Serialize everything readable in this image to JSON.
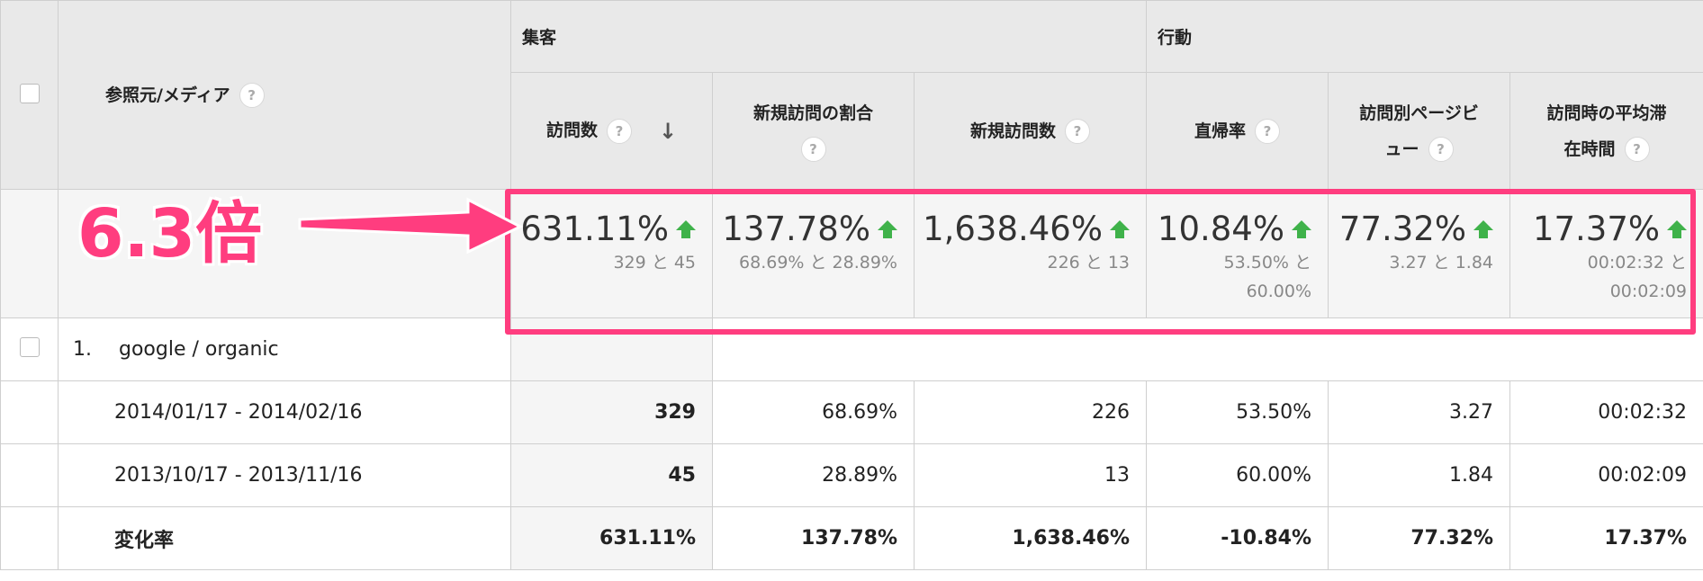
{
  "table": {
    "source_header": "参照元/メディア",
    "group_acquisition": "集客",
    "group_behavior": "行動",
    "columns": [
      {
        "label_lines": [
          "訪問数"
        ],
        "sorted": true
      },
      {
        "label_lines": [
          "新規訪問の割合"
        ]
      },
      {
        "label_lines": [
          "新規訪問数"
        ]
      },
      {
        "label_lines": [
          "直帰率"
        ]
      },
      {
        "label_lines": [
          "訪問別ページビ",
          "ュー"
        ]
      },
      {
        "label_lines": [
          "訪問時の平均滞",
          "在時間"
        ]
      }
    ],
    "summary": [
      {
        "pct": "631.11%",
        "lines": [
          "329 と 45"
        ]
      },
      {
        "pct": "137.78%",
        "lines": [
          "68.69% と 28.89%"
        ]
      },
      {
        "pct": "1,638.46%",
        "lines": [
          "226 と 13"
        ]
      },
      {
        "pct": "10.84%",
        "lines": [
          "53.50% と",
          "60.00%"
        ]
      },
      {
        "pct": "77.32%",
        "lines": [
          "3.27 と 1.84"
        ]
      },
      {
        "pct": "17.37%",
        "lines": [
          "00:02:32 と",
          "00:02:09"
        ]
      }
    ],
    "source_row": {
      "index": "1.",
      "name": "google / organic"
    },
    "rows": [
      {
        "label": "2014/01/17 - 2014/02/16",
        "values": [
          "329",
          "68.69%",
          "226",
          "53.50%",
          "3.27",
          "00:02:32"
        ]
      },
      {
        "label": "2013/10/17 - 2013/11/16",
        "values": [
          "45",
          "28.89%",
          "13",
          "60.00%",
          "1.84",
          "00:02:09"
        ]
      },
      {
        "label": "変化率",
        "values": [
          "631.11%",
          "137.78%",
          "1,638.46%",
          "-10.84%",
          "77.32%",
          "17.37%"
        ]
      }
    ]
  },
  "annotation": {
    "text": "6.3倍",
    "color": "#ff3d7f"
  },
  "icons": {
    "help": "?",
    "sort": "↓"
  }
}
